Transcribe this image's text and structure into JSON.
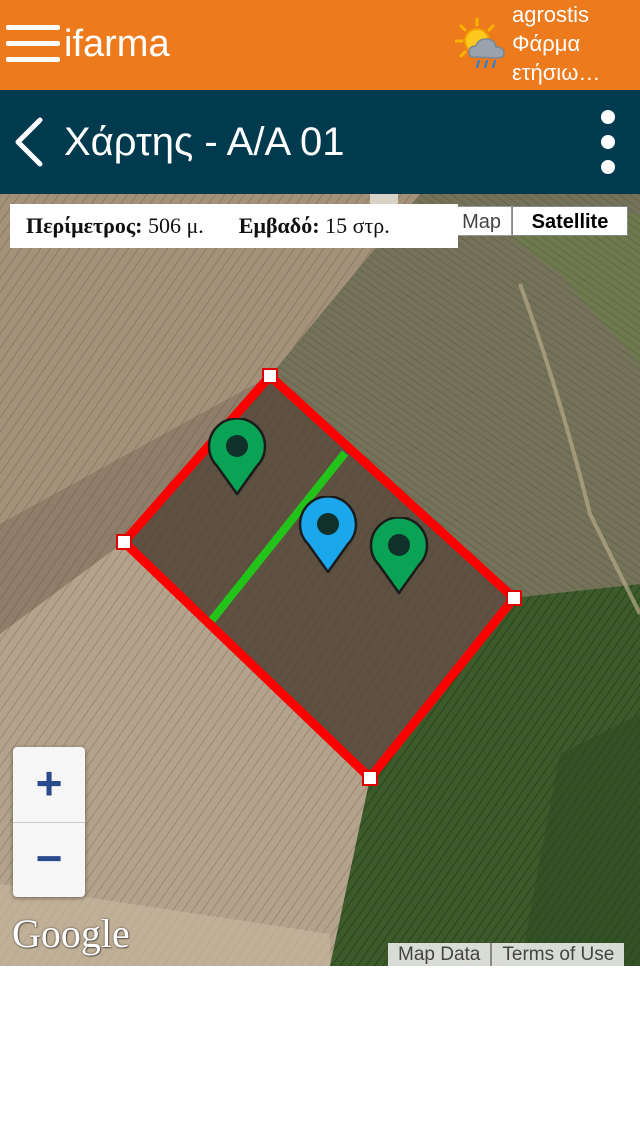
{
  "header": {
    "brand": "ifarma",
    "farm": {
      "user": "agrostis",
      "name": "Φάρμα",
      "season": "ετήσιω…"
    },
    "icons": {
      "menu": "hamburger-icon",
      "weather": "partly-cloudy-rain-icon"
    },
    "colors": {
      "background": "#ed7a1c",
      "text": "#ffffff"
    }
  },
  "titlebar": {
    "title": "Χάρτης - Α/Α 01",
    "icons": {
      "back": "chevron-left-icon",
      "more": "kebab-menu-icon"
    },
    "colors": {
      "background": "#003a4f"
    }
  },
  "map": {
    "stats": {
      "perimeter_label": "Περίμετρος:",
      "perimeter_value": "506 μ.",
      "area_label": "Εμβαδό:",
      "area_value": "15 στρ."
    },
    "maptype": {
      "map": "Map",
      "satellite": "Satellite",
      "selected": "Satellite"
    },
    "zoom": {
      "in": "+",
      "out": "−"
    },
    "logo": "Google",
    "attribution": {
      "data": "Map Data",
      "terms": "Terms of Use"
    },
    "colors": {
      "field_boundary": "#ff0000",
      "split_line": "#22c41a",
      "marker_green": "#0aa255",
      "marker_blue": "#1aa7ec"
    },
    "markers": [
      {
        "color": "green"
      },
      {
        "color": "blue"
      },
      {
        "color": "green"
      }
    ]
  }
}
